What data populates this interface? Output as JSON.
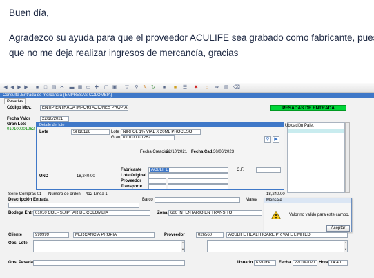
{
  "email": {
    "greeting": "Buen día,",
    "line1": "Agradezco su ayuda para que el proveedor ACULIFE sea grabado como fabricante, puesto",
    "line2": "que no me deja realizar ingresos de mercancía, gracias"
  },
  "window": {
    "title": "Consulta /Entrada de mercancía (EMPRESAS COLOMBIA)",
    "tab": "Pesadas"
  },
  "header": {
    "codigo_label": "Código Mov.",
    "codigo_value": "ENTIP ENTRADA IMPORTACIONES PROPIAS",
    "status": "PESADAS DE ENTRADA",
    "fecha_valor_label": "Fecha Valor",
    "fecha_valor_value": "22/10/2021",
    "gran_lote_label": "Gran Lote",
    "gran_lote_value": "010100001262"
  },
  "lote_panel": {
    "title": "Detalle del lote",
    "lote_label": "Lote",
    "lote_value": "SH10126",
    "lote2_label": "Lote",
    "lote2_value": "NIRFOL 1% VIAL X 20ML PROCESO",
    "gran_lote_label": "Gran lo",
    "gran_lote_value": "010100001262",
    "fecha_creacion_label": "Fecha Creación",
    "fecha_creacion_value": "22/10/2021",
    "fecha_cad_label": "Fecha Cad.",
    "fecha_cad_value": "30/06/2023",
    "und_label": "UND",
    "und_value": "18,240.00",
    "cf_label": "C.F.",
    "fabricante_label": "Fabricante",
    "fabricante_value": "ACULIFE",
    "lote_original_label": "Lote Original",
    "proveedor_label": "Proveedor",
    "transporte_label": "Transporte"
  },
  "grid": {
    "col1": "Ubicación",
    "col2": "Palet"
  },
  "serie_row": {
    "serie": "Serie Compras 01",
    "numero_orden": "Número de orden",
    "linea": "412 Línea 1",
    "total": "18,240.00"
  },
  "form": {
    "descripcion_label": "Descripción Entrada",
    "barco_label": "Barco",
    "marea_label": "Marea",
    "bodega_label": "Bodega Entra",
    "bodega_value": "01010  COL - SUIPHAR DE COLOMBIA",
    "zona_label": "Zona",
    "zona_value": "600   INTENTARIO EN TRANSITO",
    "cliente_label": "Cliente",
    "cliente_code": "999999",
    "cliente_name": "MERCANCIA PROPIA",
    "proveedor_label": "Proveedor",
    "proveedor_code": "026560",
    "proveedor_name": "ACULIFE HEALTHCARE PRIVATE LIMITED",
    "obs_lote_label": "Obs. Lote",
    "obs_pesada_label": "Obs. Pesada",
    "usuario_label": "Usuario",
    "usuario_value": "KMOYA",
    "fecha_label": "Fecha",
    "fecha_value": "22/10/2021",
    "hora_label": "Hora",
    "hora_value": "14:40"
  },
  "dialog": {
    "title": "Mensaje",
    "message": "Valor no valido para este campo.",
    "button": "Aceptar"
  },
  "colors": {
    "accent": "#3f78c8",
    "status_green": "#00d639",
    "email_text": "#1f2a44"
  }
}
